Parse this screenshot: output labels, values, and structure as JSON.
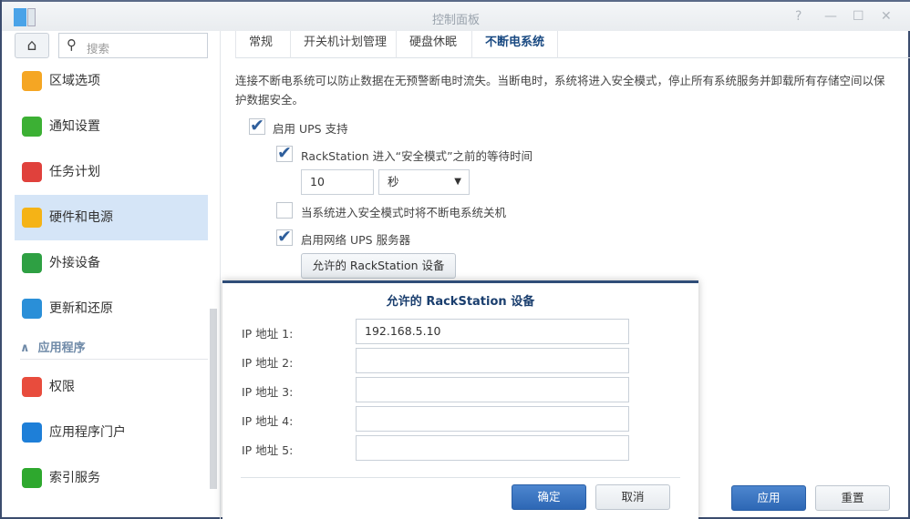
{
  "window": {
    "title": "控制面板"
  },
  "sidebar": {
    "search_placeholder": "搜索",
    "items": [
      {
        "label": "区域选项",
        "icon": "map-clock-icon",
        "color": "#f5a623"
      },
      {
        "label": "通知设置",
        "icon": "chat-bubble-icon",
        "color": "#3cb034"
      },
      {
        "label": "任务计划",
        "icon": "calendar-icon",
        "color": "#e0413c"
      },
      {
        "label": "硬件和电源",
        "icon": "lightbulb-icon",
        "color": "#f5b316",
        "selected": true
      },
      {
        "label": "外接设备",
        "icon": "upload-icon",
        "color": "#2ea043"
      },
      {
        "label": "更新和还原",
        "icon": "refresh-icon",
        "color": "#2a8fd8"
      }
    ],
    "section": "应用程序",
    "items2": [
      {
        "label": "权限",
        "icon": "permissions-icon",
        "color": "#e84c3d"
      },
      {
        "label": "应用程序门户",
        "icon": "portal-icon",
        "color": "#1e7fd8"
      },
      {
        "label": "索引服务",
        "icon": "index-search-icon",
        "color": "#2ea82e"
      }
    ]
  },
  "tabs": [
    "常规",
    "开关机计划管理",
    "硬盘休眠",
    "不断电系统"
  ],
  "active_tab": "不断电系统",
  "ups": {
    "description": "连接不断电系统可以防止数据在无预警断电时流失。当断电时，系统将进入安全模式，停止所有系统服务并卸载所有存储空间以保护数据安全。",
    "enable_ups": {
      "label": "启用 UPS 支持",
      "checked": true
    },
    "wait_time": {
      "label": "RackStation 进入“安全模式”之前的等待时间",
      "checked": true,
      "value": "10",
      "unit": "秒"
    },
    "shutdown_ups": {
      "label": "当系统进入安全模式时将不断电系统关机",
      "checked": false
    },
    "network_ups": {
      "label": "启用网络 UPS 服务器",
      "checked": true
    },
    "allowed_button": "允许的 RackStation 设备"
  },
  "footer": {
    "apply": "应用",
    "reset": "重置"
  },
  "dialog": {
    "title": "允许的 RackStation 设备",
    "fields": [
      {
        "label": "IP 地址 1:",
        "value": "192.168.5.10"
      },
      {
        "label": "IP 地址 2:",
        "value": ""
      },
      {
        "label": "IP 地址 3:",
        "value": ""
      },
      {
        "label": "IP 地址 4:",
        "value": ""
      },
      {
        "label": "IP 地址 5:",
        "value": ""
      }
    ],
    "ok": "确定",
    "cancel": "取消"
  }
}
